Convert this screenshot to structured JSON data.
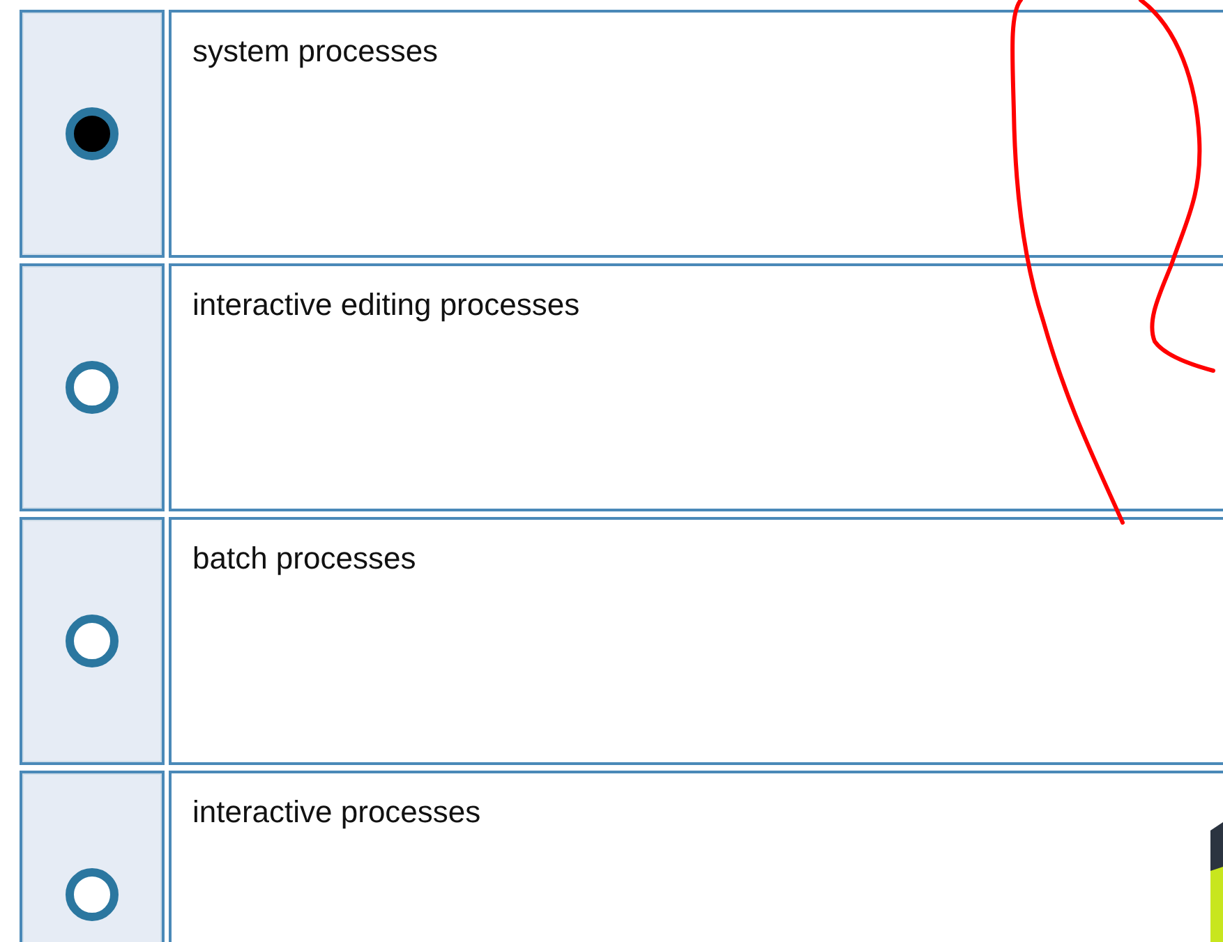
{
  "options": [
    {
      "label": "system processes",
      "selected": true
    },
    {
      "label": "interactive editing processes",
      "selected": false
    },
    {
      "label": "batch processes",
      "selected": false
    },
    {
      "label": "interactive processes",
      "selected": false
    }
  ]
}
